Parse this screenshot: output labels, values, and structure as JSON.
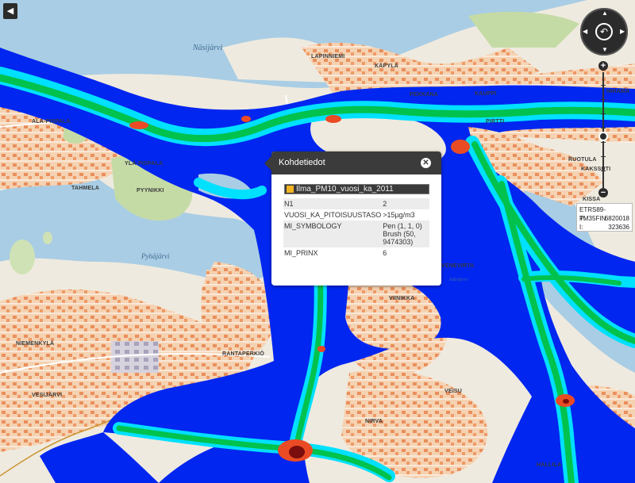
{
  "map": {
    "lakes": {
      "north": "Näsijärvi",
      "west": "Pyhäjärvi",
      "east": "Iidesjärvi"
    },
    "place_labels": [
      "LAPINNIEMI",
      "KÄPYLÄ",
      "PEKKANA",
      "KAUPPI",
      "ALA-PISPALA",
      "YLÄ-PISPALA",
      "TAHMELA",
      "PYYNIKKI",
      "NIEMENKYLÄ",
      "RANTAPERKIÖ",
      "VESIJÄRVI",
      "VIINIKKA",
      "NIRVA",
      "VEISU",
      "HALLILA",
      "RUOTULA",
      "KAKSSUTI",
      "NIHAMA",
      "KISSA",
      "PIRTTI",
      "VENEVIRTA"
    ]
  },
  "controls": {
    "back_icon": "chevron-left-icon",
    "back_glyph": "◀",
    "compass_center_glyph": "↶",
    "zoom_in": "+",
    "zoom_out": "−",
    "zoom_level_fraction": 0.56
  },
  "coordinates": {
    "crs": "ETRS89-TM35FIN",
    "p_label": "P:",
    "p_value": "6820018",
    "i_label": "I:",
    "i_value": "323636"
  },
  "popup": {
    "title": "Kohdetiedot",
    "close_glyph": "✕",
    "layer_name": "Ilma_PM10_vuosi_ka_2011",
    "layer_color": "#f3b523",
    "rows": [
      {
        "key": "N1",
        "value": "2"
      },
      {
        "key": "VUOSI_KA_PITOISUUSTASO",
        "value": ">15µg/m3"
      },
      {
        "key": "MI_SYMBOLOGY",
        "value": "Pen (1, 1, 0) Brush (50, 9474303)"
      },
      {
        "key": "MI_PRINX",
        "value": "6"
      }
    ]
  },
  "colors": {
    "water": "#a9cde4",
    "land": "#efeadf",
    "urban": "#f3c9a4",
    "park": "#c5dba6",
    "pm_low": "#0026f0",
    "pm_mid": "#00e0ff",
    "pm_high": "#00c24d",
    "pm_top": "#ea4b24",
    "pm_peak": "#7a0d0d"
  }
}
